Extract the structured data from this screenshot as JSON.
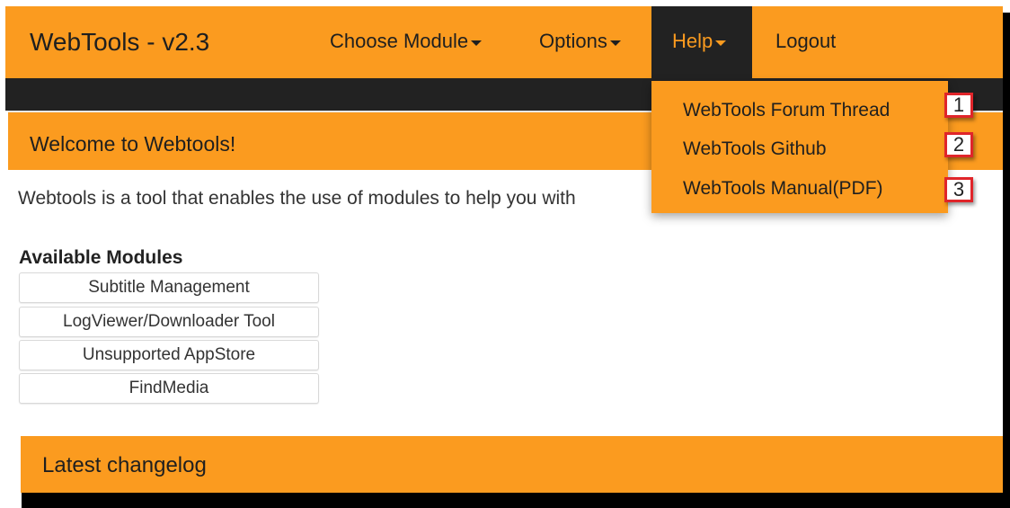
{
  "navbar": {
    "brand": "WebTools - v2.3",
    "items": [
      {
        "label": "Choose Module",
        "has_caret": true
      },
      {
        "label": "Options",
        "has_caret": true
      },
      {
        "label": "Help",
        "has_caret": true,
        "active": true
      },
      {
        "label": "Logout",
        "has_caret": false
      }
    ]
  },
  "help_menu": {
    "items": [
      {
        "label": "WebTools Forum Thread",
        "marker": "1"
      },
      {
        "label": "WebTools Github",
        "marker": "2"
      },
      {
        "label": "WebTools Manual(PDF)",
        "marker": "3"
      }
    ]
  },
  "welcome": {
    "title": "Welcome to Webtools!",
    "intro": "Webtools is a tool that enables the use of modules to help you with"
  },
  "modules": {
    "heading": "Available Modules",
    "items": [
      "Subtitle Management",
      "LogViewer/Downloader Tool",
      "Unsupported AppStore",
      "FindMedia"
    ]
  },
  "changelog": {
    "title": "Latest changelog"
  },
  "colors": {
    "accent": "#fb9b1f",
    "dark": "#222222",
    "marker_border": "#e0252a"
  }
}
